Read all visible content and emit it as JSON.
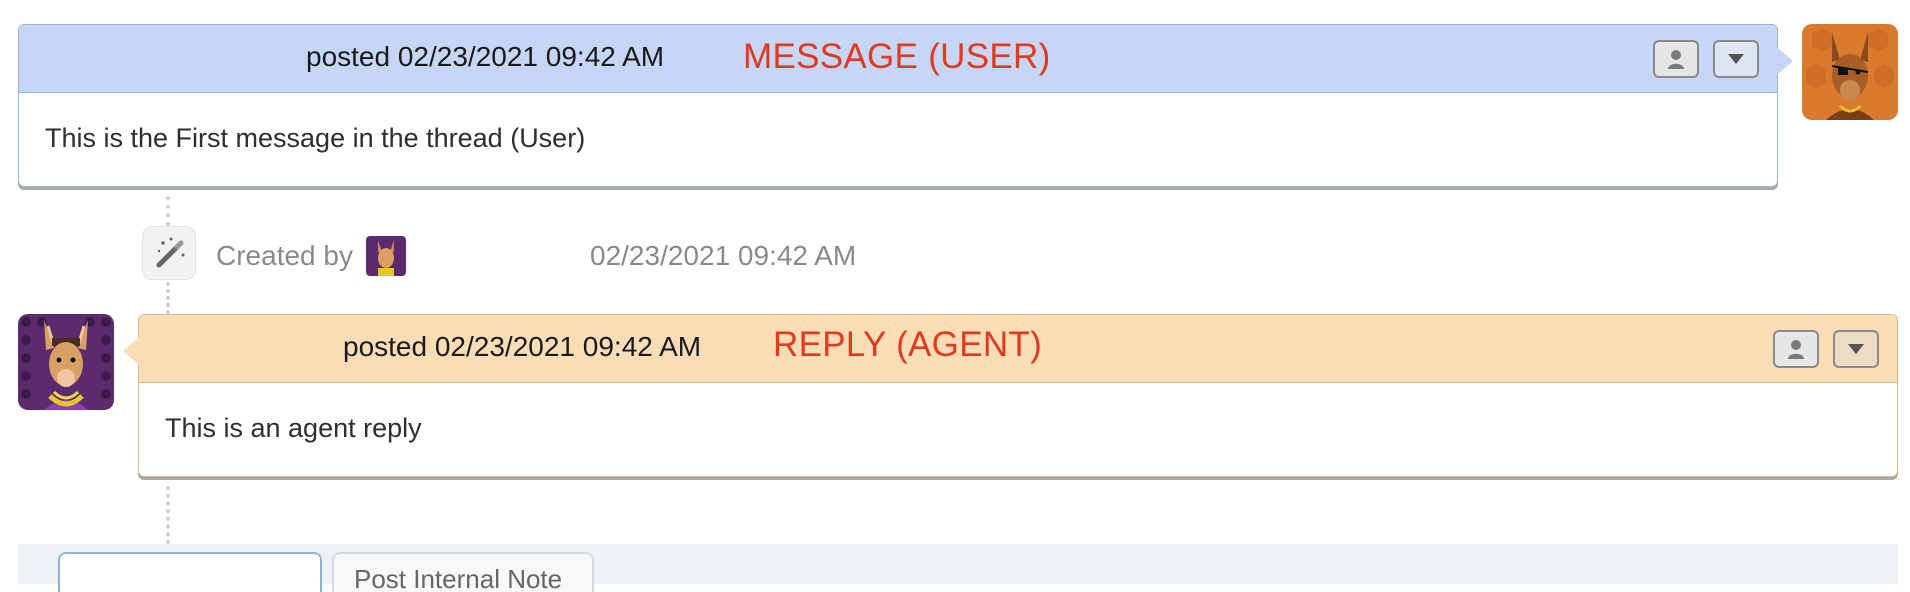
{
  "thread": {
    "user_message": {
      "posted_label": "posted 02/23/2021 09:42 AM",
      "annotation": "MESSAGE (USER)",
      "body": "This is the First message in the thread (User)"
    },
    "event": {
      "created_by_label": "Created by",
      "timestamp": "02/23/2021 09:42 AM"
    },
    "agent_reply": {
      "posted_label": "posted 02/23/2021 09:42 AM",
      "annotation": "REPLY (AGENT)",
      "body": "This is an agent reply"
    }
  },
  "composer": {
    "tabs": [
      {
        "label": ""
      },
      {
        "label": "Post Internal Note"
      }
    ]
  },
  "colors": {
    "user_header": "#c6d6f7",
    "agent_header": "#f8ddb6",
    "annotation": "#e2391f"
  },
  "icons": [
    "person-icon",
    "caret-down-icon",
    "magic-wand-icon"
  ]
}
